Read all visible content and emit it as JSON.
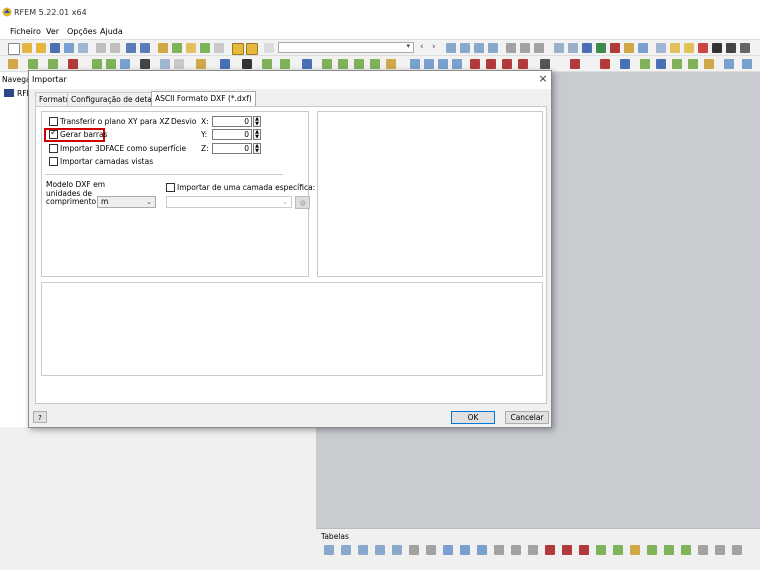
{
  "app": {
    "title": "RFEM 5.22.01 x64"
  },
  "menu": {
    "items": [
      "Ficheiro",
      "Ver",
      "Opções",
      "Ajuda"
    ]
  },
  "toolbar": {
    "dropdown_value": ""
  },
  "navigator": {
    "title": "Navega",
    "root_label": "RFE"
  },
  "dialog": {
    "title": "Importar",
    "close_glyph": "×",
    "tabs": [
      "Formato",
      "Configuração de detalhes",
      "ASCII Formato DXF (*.dxf)"
    ],
    "active_tab": 2,
    "options": {
      "transfer_xy": {
        "label": "Transferir o plano XY para XZ",
        "checked": false
      },
      "generate_bars": {
        "label": "Gerar barras",
        "checked": true
      },
      "import_3dface": {
        "label": "Importar 3DFACE como superfície",
        "checked": false
      },
      "import_visible_layers": {
        "label": "Importar camadas vistas",
        "checked": false
      }
    },
    "offset": {
      "label": "Desvio",
      "x_label": "X:",
      "x_value": "0",
      "y_label": "Y:",
      "y_value": "0",
      "z_label": "Z:",
      "z_value": "0"
    },
    "model_units": {
      "label_line1": "Modelo DXF em",
      "label_line2": "unidades de",
      "label_line3": "comprimento:",
      "value": "m"
    },
    "specific_layer": {
      "label": "Importar de uma camada específica:",
      "checked": false,
      "value": ""
    },
    "buttons": {
      "ok": "OK",
      "cancel": "Cancelar"
    }
  },
  "tables_panel": {
    "title": "Tabelas"
  },
  "colors": {
    "highlight": "#cc0000",
    "workspace": "#c8ccd1",
    "accent": "#0078d7"
  }
}
